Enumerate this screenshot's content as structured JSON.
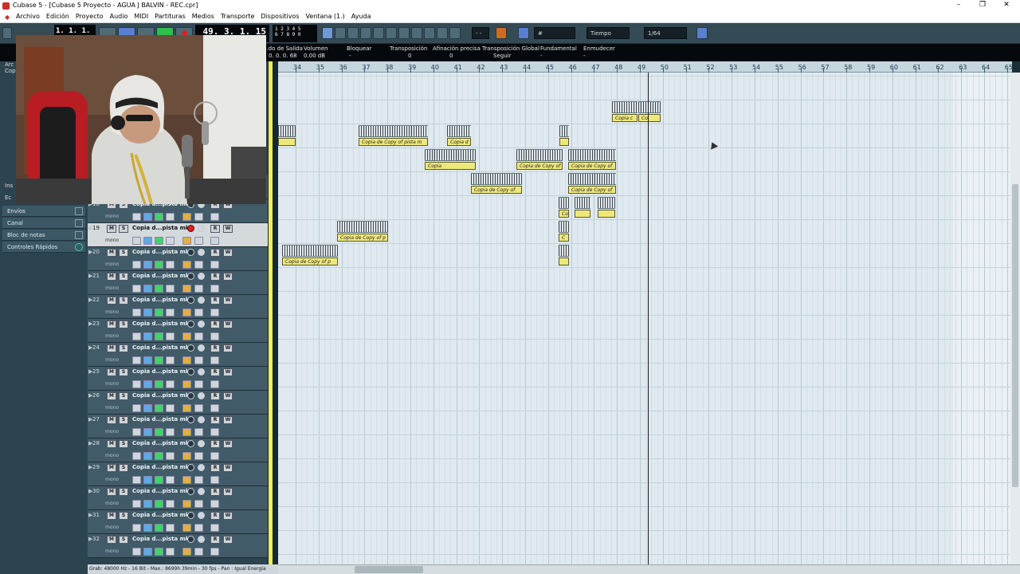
{
  "window": {
    "title": "Cubase 5 - [Cubase 5 Proyecto - AGUA J BALVIN - REC.cpr]",
    "minimize": "–",
    "maximize": "❐",
    "close": "✕"
  },
  "menu": [
    "Archivo",
    "Edición",
    "Proyecto",
    "Audio",
    "MIDI",
    "Partituras",
    "Medios",
    "Transporte",
    "Dispositivos",
    "Ventana (1.)",
    "Ayuda"
  ],
  "toolbar": {
    "position_left": "1. 1. 1.  0",
    "position_main": "49. 3. 1. 15",
    "marker_digits": "1 2 3 4 5\n6 7 8 9 0",
    "snap_value": "- -",
    "grid_mode": "Tiempo",
    "quantize": "1/64"
  },
  "infoline": {
    "fields": [
      {
        "label": "...do de Salida",
        "value": "0. 0. 0. 68"
      },
      {
        "label": "Volumen",
        "value": "0.00 dB"
      },
      {
        "label": "Bloquear",
        "value": "-"
      },
      {
        "label": "Transposición",
        "value": "0"
      },
      {
        "label": "Afinación precisa",
        "value": "0"
      },
      {
        "label": "Transposición Global",
        "value": "Seguir"
      },
      {
        "label": "Fundamental",
        "value": "-"
      },
      {
        "label": "Enmudecer",
        "value": "-"
      }
    ]
  },
  "inspector": {
    "partial_labels": [
      "Arc",
      "Cop",
      "Ins",
      "Ec"
    ],
    "sections": [
      "Envíos",
      "Canal",
      "Bloc de notas",
      "Controles Rápidos"
    ]
  },
  "tracks": [
    {
      "num": "",
      "name": "",
      "mode": "mono",
      "selected": false
    },
    {
      "num": "18",
      "name": "Copia d...pista mk",
      "mode": "mono",
      "selected": false
    },
    {
      "num": "19",
      "name": "Copia d...pista mk",
      "mode": "mono",
      "selected": true
    },
    {
      "num": "20",
      "name": "Copia d...pista mk",
      "mode": "mono",
      "selected": false
    },
    {
      "num": "21",
      "name": "Copia d...pista mk",
      "mode": "mono",
      "selected": false
    },
    {
      "num": "22",
      "name": "Copia d...pista mk",
      "mode": "mono",
      "selected": false
    },
    {
      "num": "23",
      "name": "Copia d...pista mk",
      "mode": "mono",
      "selected": false
    },
    {
      "num": "24",
      "name": "Copia d...pista mk",
      "mode": "mono",
      "selected": false
    },
    {
      "num": "25",
      "name": "Copia d...pista mk",
      "mode": "mono",
      "selected": false
    },
    {
      "num": "26",
      "name": "Copia d...pista mk",
      "mode": "mono",
      "selected": false
    },
    {
      "num": "27",
      "name": "Copia d...pista mk",
      "mode": "mono",
      "selected": false
    },
    {
      "num": "28",
      "name": "Copia d...pista mk",
      "mode": "mono",
      "selected": false
    },
    {
      "num": "29",
      "name": "Copia d...pista mk",
      "mode": "mono",
      "selected": false
    },
    {
      "num": "30",
      "name": "Copia d...pista mk",
      "mode": "mono",
      "selected": false
    },
    {
      "num": "31",
      "name": "Copia d...pista mk",
      "mode": "mono",
      "selected": false
    },
    {
      "num": "32",
      "name": "Copia d...pista mk",
      "mode": "mono",
      "selected": false
    }
  ],
  "ruler": {
    "bars": [
      "34",
      "35",
      "36",
      "37",
      "38",
      "39",
      "40",
      "41",
      "42",
      "43",
      "44",
      "45",
      "46",
      "47",
      "48",
      "49",
      "50",
      "51",
      "52",
      "53",
      "54",
      "55",
      "56",
      "57",
      "58",
      "59",
      "60",
      "61",
      "62",
      "63",
      "64",
      "65"
    ]
  },
  "events": [
    {
      "label": "Copia de Copy of pista m"
    },
    {
      "label": "Copia d"
    },
    {
      "label": "Copia"
    },
    {
      "label": "Copia de Copy of"
    },
    {
      "label": "Copia de Copy of"
    },
    {
      "label": "Copia de Copy of"
    },
    {
      "label": "Copia de Copy of p"
    },
    {
      "label": "Copia de Copy of"
    },
    {
      "label": "Copia c"
    },
    {
      "label": "Co"
    },
    {
      "label": "Co"
    },
    {
      "label": "C"
    },
    {
      "label": "Copia de Copy of p"
    }
  ],
  "statusbar": "Grab: 48000 Hz - 16 Bit - Max.: 8699h 39min - 30 fps - Pan : Igual Energía"
}
